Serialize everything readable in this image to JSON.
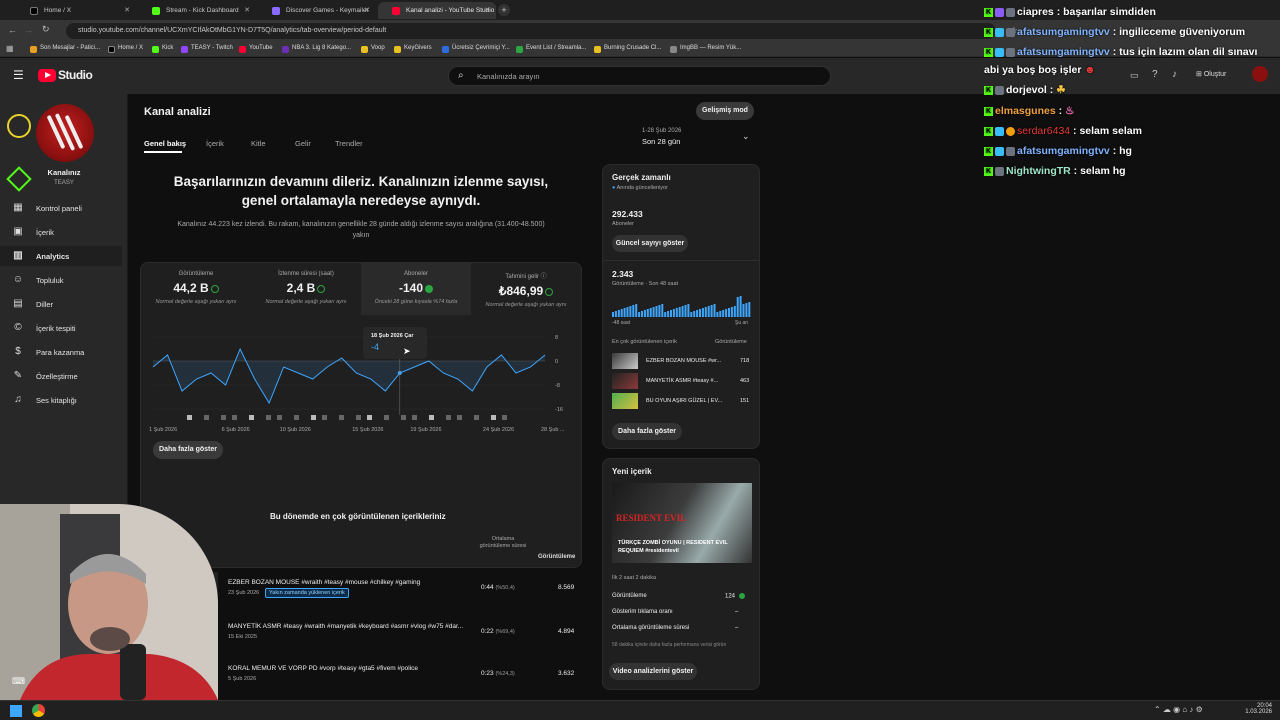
{
  "browser": {
    "tabs": [
      {
        "title": "Home / X"
      },
      {
        "title": "Stream - Kick Dashboard"
      },
      {
        "title": "Discover Games - Keymailer"
      },
      {
        "title": "Kanal analizi - YouTube Studio"
      }
    ],
    "url": "studio.youtube.com/channel/UCXmYCIfAkOtMbG1YN-D7T5Q/analytics/tab-overview/period-default",
    "bookmarks": [
      "Son Mesajlar - Patici...",
      "Home / X",
      "Kick",
      "TEASY - Twitch",
      "YouTube",
      "NBA 3. Lig 8 Katego...",
      "Voop",
      "KeyGivers",
      "Ücretsiz Çevrimiçi Y...",
      "Event List / Streamla...",
      "Burning Crusade Cl...",
      "ImgBB — Resim Yük..."
    ]
  },
  "header": {
    "logo": "Studio",
    "search_placeholder": "Kanalınızda arayın",
    "create_label": "Oluştur"
  },
  "sidebar": {
    "channel_label": "Kanalınız",
    "channel_name": "TEASY",
    "items": [
      {
        "label": "Kontrol paneli",
        "icon": "dashboard-icon"
      },
      {
        "label": "İçerik",
        "icon": "content-icon"
      },
      {
        "label": "Analytics",
        "icon": "analytics-icon"
      },
      {
        "label": "Topluluk",
        "icon": "community-icon"
      },
      {
        "label": "Diller",
        "icon": "languages-icon"
      },
      {
        "label": "İçerik tespiti",
        "icon": "content-detection-icon"
      },
      {
        "label": "Para kazanma",
        "icon": "monetization-icon"
      },
      {
        "label": "Özelleştirme",
        "icon": "customization-icon"
      },
      {
        "label": "Ses kitaplığı",
        "icon": "audio-library-icon"
      }
    ]
  },
  "page": {
    "title": "Kanal analizi",
    "advanced_mode": "Gelişmiş mod",
    "tabs": [
      "Genel bakış",
      "İçerik",
      "Kitle",
      "Gelir",
      "Trendler"
    ],
    "date_range": "1-28 Şub 2026",
    "date_period": "Son 28 gün"
  },
  "overview": {
    "headline": "Başarılarınızın devamını dileriz. Kanalınızın izlenme sayısı, genel ortalamayla neredeyse aynıydı.",
    "description": "Kanalınız 44.223 kez izlendi. Bu rakam, kanalınızın genellikle 28 günde aldığı izlenme sayısı aralığına (31.400-48.500) yakın",
    "metrics": [
      {
        "label": "Görüntüleme",
        "value": "44,2 B",
        "sub": "Normal değerle aşağı yukarı aynı"
      },
      {
        "label": "İzlenme süresi (saat)",
        "value": "2,4 B",
        "sub": "Normal değerle aşağı yukarı aynı"
      },
      {
        "label": "Aboneler",
        "value": "-140",
        "sub": "Önceki 28 güne kıyasla %74 fazla"
      },
      {
        "label": "Tahmini gelir",
        "value": "₺846,99",
        "sub": "Normal değerle aşağı yukarı aynı"
      }
    ],
    "tooltip_date": "18 Şub 2026 Çar",
    "tooltip_value": "-4",
    "show_more": "Daha fazla göster"
  },
  "chart_data": {
    "type": "line",
    "x": [
      "1 Şub 2026",
      "6 Şub 2026",
      "10 Şub 2026",
      "15 Şub 2026",
      "19 Şub 2026",
      "24 Şub 2026",
      "28 Şub ..."
    ],
    "x_positions": [
      1,
      6,
      10,
      15,
      19,
      24,
      28
    ],
    "series": [
      {
        "values": [
          -2,
          2,
          -10,
          -6,
          -4,
          -8,
          4,
          -6,
          -14,
          -2,
          -4,
          -6,
          -2,
          1,
          -4,
          -6,
          -10,
          -4,
          -2,
          0,
          -4,
          -6,
          -10,
          -2,
          2,
          -4,
          -2,
          2
        ]
      }
    ],
    "ylim": [
      -16,
      8
    ],
    "yticks": [
      8,
      0,
      -8,
      -16
    ],
    "grid": true
  },
  "realtime": {
    "title": "Gerçek zamanlı",
    "subtitle": "Anında güncelleniyor",
    "subscribers": "292.433",
    "subscribers_label": "Aboneler",
    "show_live_count": "Güncel sayıyı göster",
    "views": "2.343",
    "views_label": "Görüntüleme · Son 48 saat",
    "axis_left": "-48 saat",
    "axis_right": "Şu an",
    "top_content_label": "En çok görüntülenen içerik",
    "top_content_col": "Görüntüleme",
    "top_items": [
      {
        "title": "EZBER BOZAN MOUSE #wr...",
        "views": "718"
      },
      {
        "title": "MANYETİK ASMR #teasy #...",
        "views": "463"
      },
      {
        "title": "BU OYUN AŞIRI GÜZEL | EV...",
        "views": "151"
      }
    ],
    "show_more": "Daha fazla göster"
  },
  "latest": {
    "title": "Yeni içerik",
    "video_title": "TÜRKÇE ZOMBİ OYUNU | RESIDENT EVIL REQUIEM #residentevil",
    "thumb_text": "RESIDENT EVIL",
    "since": "İlk 2 saat 2 dakika",
    "stats": [
      {
        "label": "Görüntüleme",
        "value": "124"
      },
      {
        "label": "Gösterim tıklama oranı",
        "value": "–"
      },
      {
        "label": "Ortalama görüntüleme süresi",
        "value": "–"
      }
    ],
    "note": "58 dakika içinde daha fazla performans verisi görün",
    "button": "Video analizlerini göster"
  },
  "top_content": {
    "title": "Bu dönemde en çok görüntülenen içerikleriniz",
    "col_avg": "Ortalama görüntüleme süresi",
    "col_views": "Görüntüleme",
    "rows": [
      {
        "title": "EZBER BOZAN MOUSE #wraith #teasy #mouse #chilkey #gaming",
        "date": "23 Şub 2026",
        "badge": "Yakın zamanda yüklenen içerik",
        "avg": "0:44",
        "pct": "(%50,4)",
        "views": "8.569"
      },
      {
        "title": "MANYETİK ASMR #teasy #wraith #manyetik #keyboard #asmr #vlog #w75 #dar...",
        "date": "15 Eki 2025",
        "badge": "",
        "avg": "0:22",
        "pct": "(%69,4)",
        "views": "4.894"
      },
      {
        "title": "KORAL MEMUR VE VORP PD #vorp #teasy #gta5 #fivem #police",
        "date": "5 Şub 2026",
        "badge": "",
        "avg": "0:23",
        "pct": "(%24,3)",
        "views": "3.632"
      }
    ]
  },
  "chat": [
    {
      "user": "ciapres",
      "color": "#ffffff",
      "msg": " : başarılar simdiden"
    },
    {
      "user": "afatsumgamingtvv",
      "color": "#7fb2ff",
      "msg": " : ingilicceme güveniyorum"
    },
    {
      "user": "afatsumgamingtvv",
      "color": "#7fb2ff",
      "msg": " : tus için lazım olan dil sınavı"
    },
    {
      "user": "",
      "color": "#ffffff",
      "msg": "abi ya boş boş işler"
    },
    {
      "user": "dorjevol",
      "color": "#ffffff",
      "msg": " :"
    },
    {
      "user": "elmasgunes",
      "color": "#f0a040",
      "msg": " :"
    },
    {
      "user": "serdar6434",
      "color": "#e53935",
      "msg": " : selam selam"
    },
    {
      "user": "afatsumgamingtvv",
      "color": "#7fb2ff",
      "msg": " : hg"
    },
    {
      "user": "NightwingTR",
      "color": "#9ee6c8",
      "msg": " : selam hg"
    }
  ],
  "taskbar": {
    "time": "20:04",
    "date": "1.03.2026"
  }
}
